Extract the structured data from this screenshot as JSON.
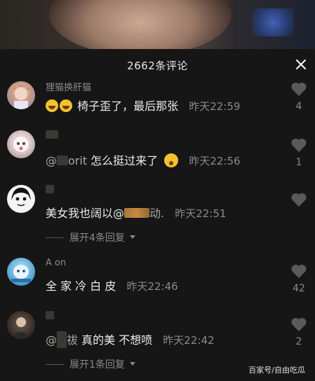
{
  "header": {
    "title": "2662条评论"
  },
  "comments": [
    {
      "username": "狸猫换肝猫",
      "text": "椅子歪了，最后那张",
      "time": "昨天22:59",
      "likes": "4"
    },
    {
      "username": "",
      "mention": "@",
      "mention_tail": "orit",
      "text": " 怎么挺过来了",
      "time": "昨天22:56",
      "likes": "1"
    },
    {
      "username": "",
      "text": "美女我也阔以@",
      "mention_tail": "动.",
      "time": "昨天22:51",
      "likes": "",
      "replies": "展开4条回复"
    },
    {
      "username": "A    on",
      "text": "全 家 冷 白 皮",
      "time": "昨天22:46",
      "likes": "42"
    },
    {
      "username": "",
      "mention": "@",
      "mention_tail": "祓",
      "text": " 真的美 不想喷",
      "time": "昨天22:42",
      "likes": "2",
      "replies": "展开1条回复"
    }
  ],
  "watermark": "百家号/自由吃瓜",
  "colors": {
    "sheet_bg": "#161616",
    "text": "#ececec",
    "muted": "#8a8a8a"
  }
}
